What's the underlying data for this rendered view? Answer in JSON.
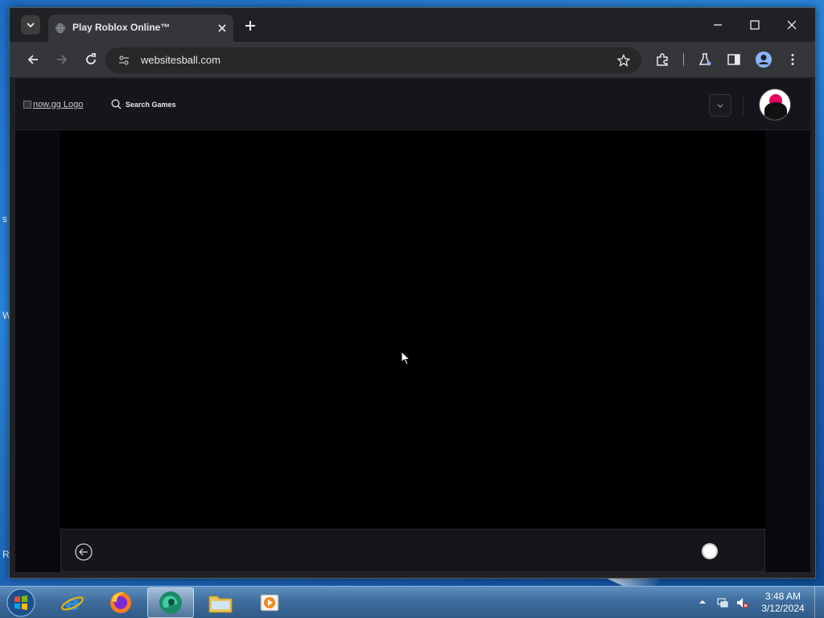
{
  "browser": {
    "tab_title": "Play Roblox Online™",
    "url": "websitesball.com"
  },
  "site": {
    "logo_alt": "now.gg Logo",
    "search_label": "Search Games"
  },
  "taskbar": {
    "time": "3:48 AM",
    "date": "3/12/2024",
    "apps": [
      "internet-explorer",
      "firefox",
      "browser-app",
      "file-explorer",
      "media-player"
    ]
  },
  "desktop": {
    "left_edge_letters": [
      "s",
      "W",
      "R"
    ]
  },
  "colors": {
    "browser_frame": "#202124",
    "toolbar": "#35363a",
    "page_bg": "#0a090f",
    "game_bg": "#000000",
    "avatar_accent": "#e6005c"
  }
}
